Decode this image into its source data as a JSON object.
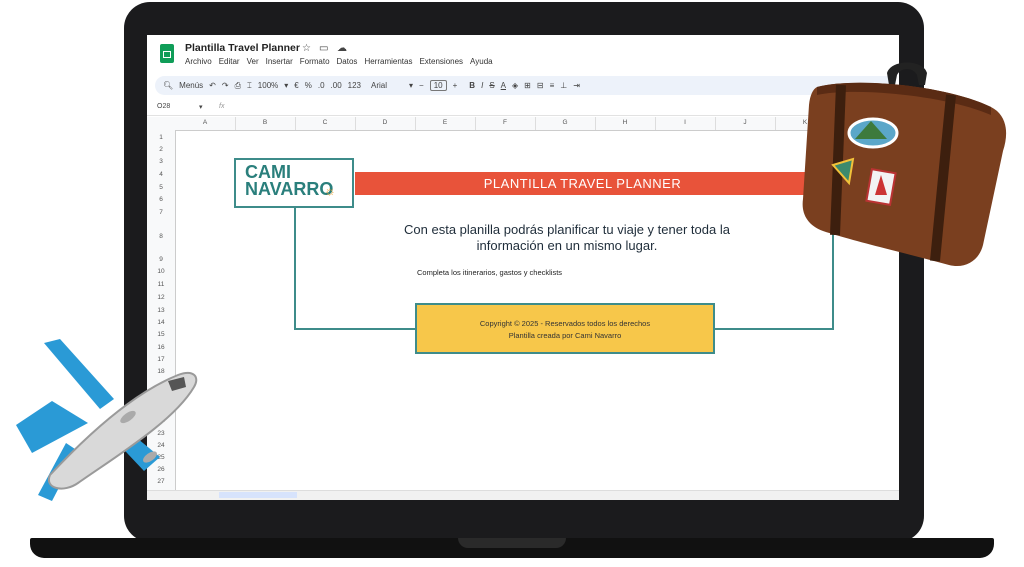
{
  "sheet": {
    "title": "Plantilla Travel Planner",
    "menu": [
      "Archivo",
      "Editar",
      "Ver",
      "Insertar",
      "Formato",
      "Datos",
      "Herramientas",
      "Extensiones",
      "Ayuda"
    ],
    "toolbar": {
      "search": "Menús",
      "zoom": "100%",
      "currency": "€",
      "percent": "%",
      "dec_down": ".0",
      "dec_up": ".00",
      "number_format": "123",
      "font": "Arial",
      "font_size": "10",
      "bold": "B",
      "italic": "I",
      "strike": "S",
      "text_color": "A"
    },
    "cell_ref": "O28",
    "fx": "fx",
    "columns": [
      "A",
      "B",
      "C",
      "D",
      "E",
      "F",
      "G",
      "H",
      "I",
      "J",
      "K"
    ],
    "rows": [
      "1",
      "2",
      "3",
      "4",
      "5",
      "6",
      "7",
      "8",
      "9",
      "10",
      "11",
      "12",
      "13",
      "14",
      "15",
      "16",
      "17",
      "18",
      "22",
      "23",
      "24",
      "25",
      "26",
      "27"
    ]
  },
  "content": {
    "brand_line1": "CAMI",
    "brand_line2": "NAVARRO",
    "banner": "PLANTILLA TRAVEL PLANNER",
    "lead_line1": "Con esta planilla podrás planificar tu viaje y tener toda la",
    "lead_line2": "información en un mismo lugar.",
    "sub": "Completa los itinerarios, gastos y checklists",
    "copyright_line1": "Copyright © 2025 - Reservados todos los derechos",
    "copyright_line2": "Plantilla creada por Cami Navarro"
  },
  "colors": {
    "banner": "#e8533a",
    "brand_teal": "#2a7f7c",
    "copyright_box": "#f7c74a",
    "sheets_green": "#0f9d58"
  }
}
